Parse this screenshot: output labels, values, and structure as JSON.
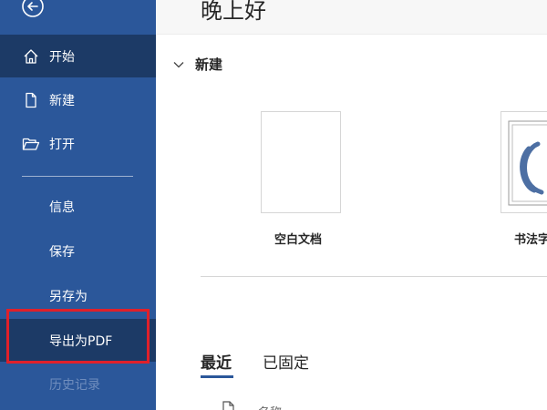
{
  "sidebar": {
    "nav_items": [
      {
        "label": "开始",
        "icon": "home-icon"
      },
      {
        "label": "新建",
        "icon": "new-document-icon"
      },
      {
        "label": "打开",
        "icon": "open-folder-icon"
      }
    ],
    "text_items": [
      {
        "label": "信息"
      },
      {
        "label": "保存"
      },
      {
        "label": "另存为"
      },
      {
        "label": "导出为PDF"
      },
      {
        "label": "历史记录"
      }
    ],
    "back_icon": "back-arrow-icon"
  },
  "main": {
    "greeting": "晚上好",
    "new_section": {
      "title": "新建",
      "templates": [
        {
          "label": "空白文档"
        },
        {
          "label": "书法字"
        }
      ]
    },
    "tabs": [
      {
        "label": "最近"
      },
      {
        "label": "已固定"
      }
    ],
    "list_header": {
      "name": "名称"
    }
  },
  "colors": {
    "sidebar_bg": "#2b579a",
    "sidebar_active": "#1c3a66",
    "highlight": "#e0202a"
  }
}
